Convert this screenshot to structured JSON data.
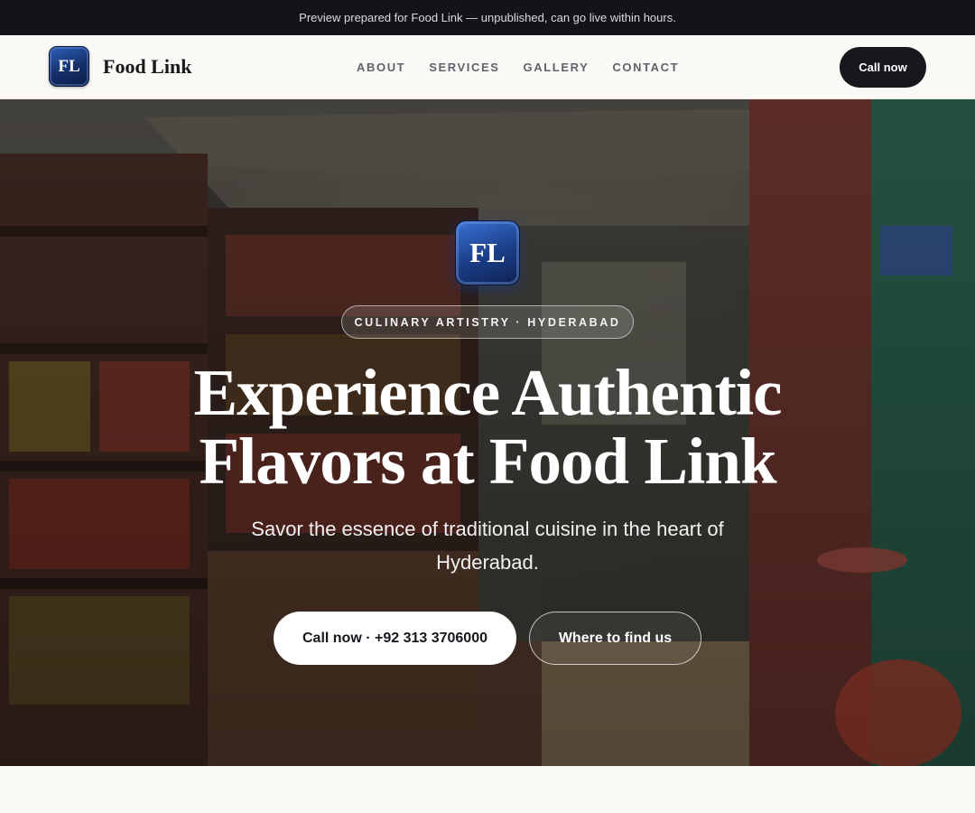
{
  "preview_bar": {
    "text": "Preview prepared for Food Link — unpublished, can go live within hours."
  },
  "header": {
    "logo_initials": "FL",
    "brand_name": "Food Link",
    "nav": [
      {
        "label": "ABOUT"
      },
      {
        "label": "SERVICES"
      },
      {
        "label": "GALLERY"
      },
      {
        "label": "CONTACT"
      }
    ],
    "call_button": "Call now"
  },
  "hero": {
    "logo_initials": "FL",
    "tagline": "CULINARY ARTISTRY · HYDERABAD",
    "title_line1": "Experience Authentic",
    "title_line2": "Flavors at Food Link",
    "subtitle": "Savor the essence of traditional cuisine in the heart of Hyderabad.",
    "primary_button": "Call now · +92 313 3706000",
    "secondary_button": "Where to find us"
  },
  "colors": {
    "dark": "#16181d",
    "brand_blue": "#1a3c85",
    "page_bg": "#faf9f6"
  }
}
